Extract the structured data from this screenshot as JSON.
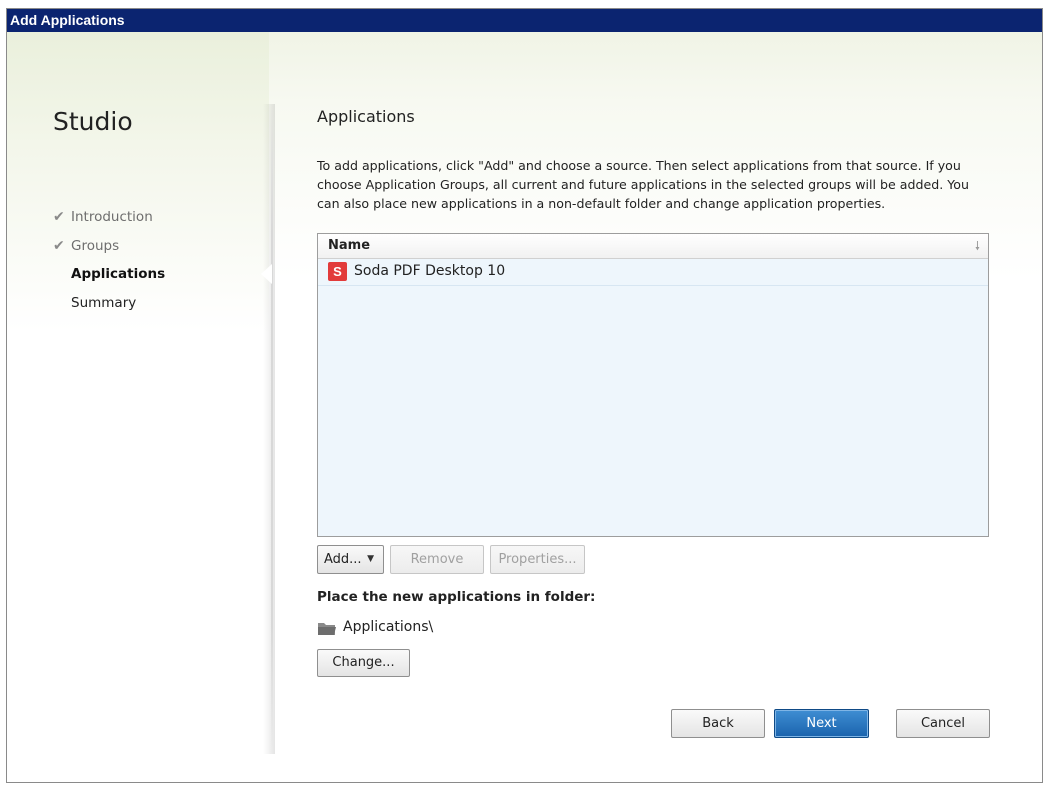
{
  "window": {
    "title": "Add Applications"
  },
  "sidebar": {
    "title": "Studio",
    "steps": [
      {
        "label": "Introduction",
        "state": "done"
      },
      {
        "label": "Groups",
        "state": "done"
      },
      {
        "label": "Applications",
        "state": "active"
      },
      {
        "label": "Summary",
        "state": "todo"
      }
    ]
  },
  "main": {
    "title": "Applications",
    "description": "To add applications, click \"Add\" and choose a source. Then select applications from that source. If you choose Application Groups, all current and future applications in the selected groups will be added. You can also place new applications in a non-default folder and change application properties.",
    "list": {
      "column_name": "Name",
      "rows": [
        {
          "icon_letter": "S",
          "name": "Soda PDF Desktop 10"
        }
      ]
    },
    "buttons": {
      "add": "Add...",
      "remove": "Remove",
      "properties": "Properties..."
    },
    "folder": {
      "label": "Place the new applications in folder:",
      "value": "Applications\\",
      "change": "Change..."
    }
  },
  "footer": {
    "back": "Back",
    "next": "Next",
    "cancel": "Cancel"
  },
  "colors": {
    "titlebar": "#0b2470",
    "next_button": "#1a63ad",
    "app_icon": "#e23b3b"
  }
}
